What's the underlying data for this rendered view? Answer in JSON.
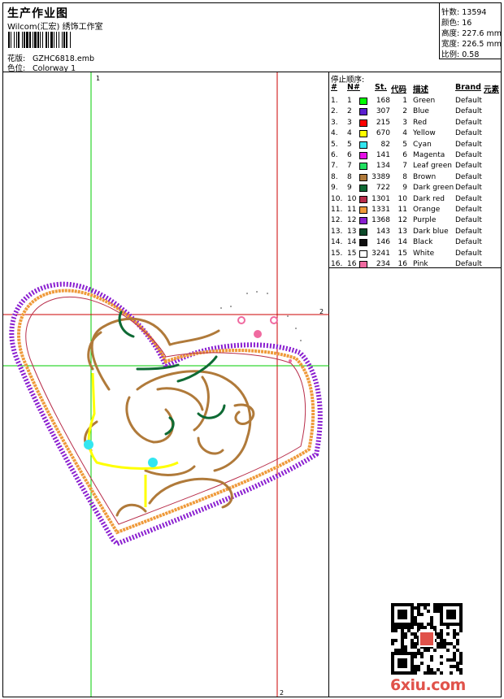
{
  "header": {
    "title": "生产作业图",
    "company": "Wilcom(汇宏) 绣饰工作室",
    "pattern_label": "花版:",
    "pattern_value": "GZHC6818.emb",
    "color_label": "色位:",
    "color_value": "Colorway 1"
  },
  "stats": {
    "stitches_label": "针数:",
    "stitches_value": "13594",
    "colors_label": "颜色:",
    "colors_value": "16",
    "height_label": "高度:",
    "height_value": "227.6 mm",
    "width_label": "宽度:",
    "width_value": "226.5 mm",
    "scale_label": "比例:",
    "scale_value": "0.58"
  },
  "design": {
    "guide_v1_label": "1",
    "guide_h1_label": "2",
    "guide_v2_label": "2"
  },
  "stop_sequence": {
    "label": "停止顺序:",
    "headers": {
      "index": "#",
      "number": "N#",
      "stitches": "St.",
      "code": "代码",
      "description": "描述",
      "brand": "Brand",
      "element": "元素"
    },
    "rows": [
      {
        "index": "1.",
        "number": "1",
        "color": "#00ff00",
        "stitches": "168",
        "code": "1",
        "description": "Green",
        "brand": "Default"
      },
      {
        "index": "2.",
        "number": "2",
        "color": "#5a1fd0",
        "stitches": "307",
        "code": "2",
        "description": "Blue",
        "brand": "Default"
      },
      {
        "index": "3.",
        "number": "3",
        "color": "#ff0000",
        "stitches": "215",
        "code": "3",
        "description": "Red",
        "brand": "Default"
      },
      {
        "index": "4.",
        "number": "4",
        "color": "#ffff00",
        "stitches": "670",
        "code": "4",
        "description": "Yellow",
        "brand": "Default"
      },
      {
        "index": "5.",
        "number": "5",
        "color": "#33e6f0",
        "stitches": "82",
        "code": "5",
        "description": "Cyan",
        "brand": "Default"
      },
      {
        "index": "6.",
        "number": "6",
        "color": "#e610e6",
        "stitches": "141",
        "code": "6",
        "description": "Magenta",
        "brand": "Default"
      },
      {
        "index": "7.",
        "number": "7",
        "color": "#20e060",
        "stitches": "134",
        "code": "7",
        "description": "Leaf green",
        "brand": "Default"
      },
      {
        "index": "8.",
        "number": "8",
        "color": "#b07a3a",
        "stitches": "3389",
        "code": "8",
        "description": "Brown",
        "brand": "Default"
      },
      {
        "index": "9.",
        "number": "9",
        "color": "#0e6a34",
        "stitches": "722",
        "code": "9",
        "description": "Dark green",
        "brand": "Default"
      },
      {
        "index": "10.",
        "number": "10",
        "color": "#b82d4a",
        "stitches": "1301",
        "code": "10",
        "description": "Dark red",
        "brand": "Default"
      },
      {
        "index": "11.",
        "number": "11",
        "color": "#ef9a3a",
        "stitches": "1331",
        "code": "11",
        "description": "Orange",
        "brand": "Default"
      },
      {
        "index": "12.",
        "number": "12",
        "color": "#8a1fd0",
        "stitches": "1368",
        "code": "12",
        "description": "Purple",
        "brand": "Default"
      },
      {
        "index": "13.",
        "number": "13",
        "color": "#0d4a2a",
        "stitches": "143",
        "code": "13",
        "description": "Dark blue",
        "brand": "Default"
      },
      {
        "index": "14.",
        "number": "14",
        "color": "#101010",
        "stitches": "146",
        "code": "14",
        "description": "Black",
        "brand": "Default"
      },
      {
        "index": "15.",
        "number": "15",
        "color": "#ffffff",
        "stitches": "3241",
        "code": "15",
        "description": "White",
        "brand": "Default"
      },
      {
        "index": "16.",
        "number": "16",
        "color": "#f06aa0",
        "stitches": "234",
        "code": "16",
        "description": "Pink",
        "brand": "Default"
      }
    ]
  },
  "watermark": "6xiu.com"
}
